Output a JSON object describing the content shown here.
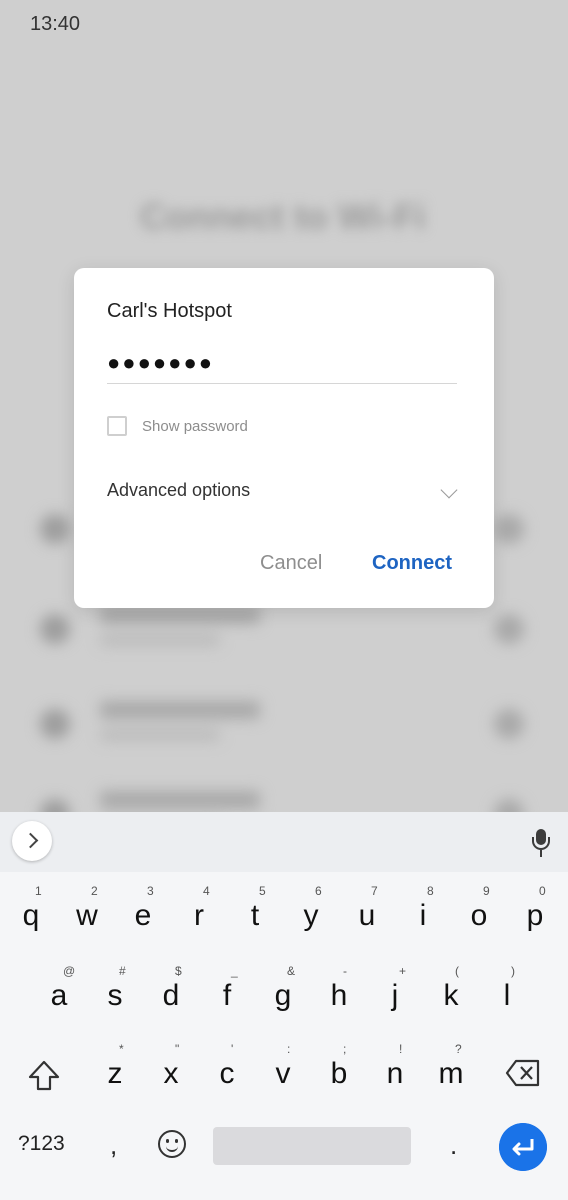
{
  "status_bar": {
    "time": "13:40"
  },
  "background": {
    "title": "Connect to Wi-Fi"
  },
  "dialog": {
    "network_name": "Carl's Hotspot",
    "password_value": "●●●●●●●",
    "show_password_label": "Show password",
    "advanced_options_label": "Advanced options",
    "cancel_label": "Cancel",
    "connect_label": "Connect"
  },
  "colors": {
    "accent": "#1e64c2",
    "enter": "#1a73e8"
  },
  "keyboard": {
    "row1": [
      {
        "key": "q",
        "hint": "1"
      },
      {
        "key": "w",
        "hint": "2"
      },
      {
        "key": "e",
        "hint": "3"
      },
      {
        "key": "r",
        "hint": "4"
      },
      {
        "key": "t",
        "hint": "5"
      },
      {
        "key": "y",
        "hint": "6"
      },
      {
        "key": "u",
        "hint": "7"
      },
      {
        "key": "i",
        "hint": "8"
      },
      {
        "key": "o",
        "hint": "9"
      },
      {
        "key": "p",
        "hint": "0"
      }
    ],
    "row2": [
      {
        "key": "a",
        "hint": "@"
      },
      {
        "key": "s",
        "hint": "#"
      },
      {
        "key": "d",
        "hint": "$"
      },
      {
        "key": "f",
        "hint": "_"
      },
      {
        "key": "g",
        "hint": "&"
      },
      {
        "key": "h",
        "hint": "-"
      },
      {
        "key": "j",
        "hint": "+"
      },
      {
        "key": "k",
        "hint": "("
      },
      {
        "key": "l",
        "hint": ")"
      }
    ],
    "row3": [
      {
        "key": "z",
        "hint": "*"
      },
      {
        "key": "x",
        "hint": "\""
      },
      {
        "key": "c",
        "hint": "'"
      },
      {
        "key": "v",
        "hint": ":"
      },
      {
        "key": "b",
        "hint": ";"
      },
      {
        "key": "n",
        "hint": "!"
      },
      {
        "key": "m",
        "hint": "?"
      }
    ],
    "symbols_label": "?123",
    "comma": ",",
    "period": ".",
    "icons": [
      "expand-icon",
      "mic-icon",
      "shift-icon",
      "backspace-icon",
      "emoji-icon",
      "enter-icon"
    ]
  }
}
